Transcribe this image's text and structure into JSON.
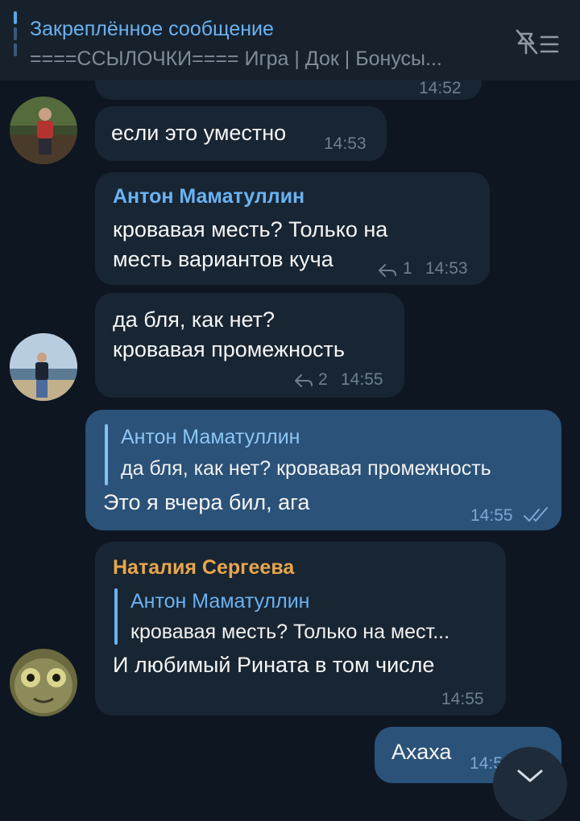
{
  "pinned": {
    "title": "Закреплённое сообщение",
    "text": "====ССЫЛОЧКИ==== Игра  |  Док  |  Бонусы..."
  },
  "messages": [
    {
      "id": "m0",
      "time": "14:52"
    },
    {
      "id": "m1",
      "text": "если это уместно",
      "time": "14:53"
    },
    {
      "id": "m2",
      "sender": "Антон Маматуллин",
      "line1": "кровавая месть? Только на",
      "line2": "месть вариантов куча",
      "replies": "1",
      "time": "14:53"
    },
    {
      "id": "m3",
      "line1": "да бля, как нет?",
      "line2": " кровавая промежность",
      "replies": "2",
      "time": "14:55"
    },
    {
      "id": "m4",
      "reply_name": "Антон Маматуллин",
      "reply_text": "да бля, как нет?  кровавая промежность",
      "text": "Это я вчера бил, ага",
      "time": "14:55"
    },
    {
      "id": "m5",
      "sender": "Наталия Сергеева",
      "reply_name": "Антон Маматуллин",
      "reply_text": "кровавая месть? Только на мест...",
      "text": "И любимый Рината в том числе",
      "time": "14:55"
    },
    {
      "id": "m6",
      "text": "Ахаха",
      "time": "14:5"
    }
  ],
  "colors": {
    "background": "#0e1621",
    "incoming": "#182533",
    "outgoing": "#2b5278",
    "accent": "#6ab2f2",
    "sender_orange": "#e8a64c"
  }
}
